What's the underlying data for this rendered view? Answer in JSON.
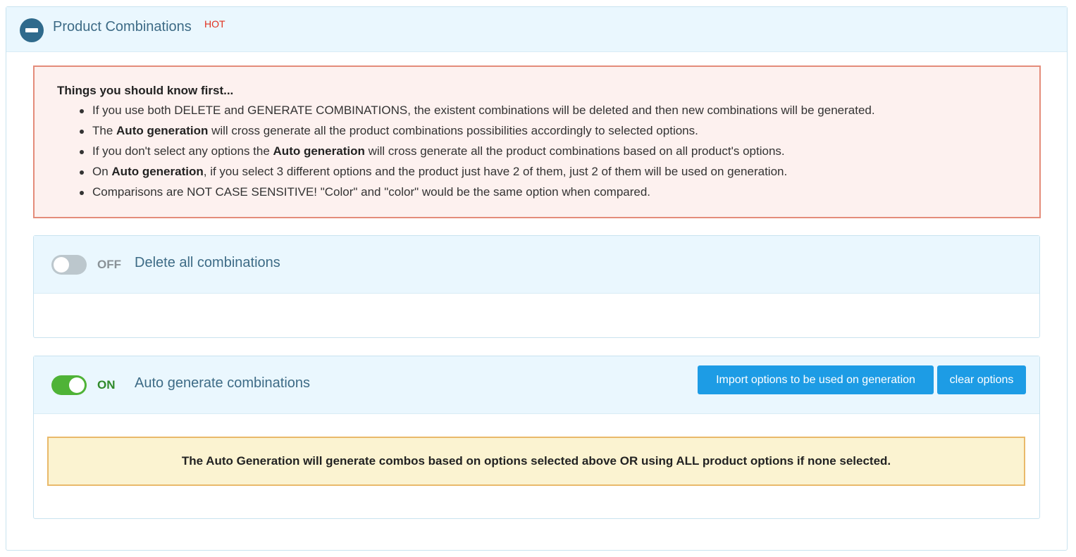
{
  "header": {
    "title": "Product Combinations",
    "badge": "HOT",
    "collapse_icon": "minus-circle-icon"
  },
  "warning": {
    "title": "Things you should know first...",
    "items": [
      {
        "pre": "If you use both DELETE and GENERATE COMBINATIONS, the existent combinations will be deleted and then new combinations will be generated.",
        "bold": "",
        "post": ""
      },
      {
        "pre": "The ",
        "bold": "Auto generation",
        "post": " will cross generate all the product combinations possibilities accordingly to selected options."
      },
      {
        "pre": "If you don't select any options the ",
        "bold": "Auto generation",
        "post": " will cross generate all the product combinations based on all product's options."
      },
      {
        "pre": "On ",
        "bold": "Auto generation",
        "post": ", if you select 3 different options and the product just have 2 of them, just 2 of them will be used on generation."
      },
      {
        "pre": "Comparisons are NOT CASE SENSITIVE! \"Color\" and \"color\" would be the same option when compared.",
        "bold": "",
        "post": ""
      }
    ]
  },
  "delete_panel": {
    "toggle_state": "OFF",
    "title": "Delete all combinations"
  },
  "auto_panel": {
    "toggle_state": "ON",
    "title": "Auto generate combinations",
    "import_button": "Import options to be used on generation",
    "clear_button": "clear options",
    "notice": "The Auto Generation will generate combos based on options selected above OR using ALL product options if none selected."
  },
  "colors": {
    "accent": "#1d9ce5",
    "toggle_on": "#4fb337",
    "toggle_off": "#bcc7cd",
    "hot": "#e0301e"
  }
}
